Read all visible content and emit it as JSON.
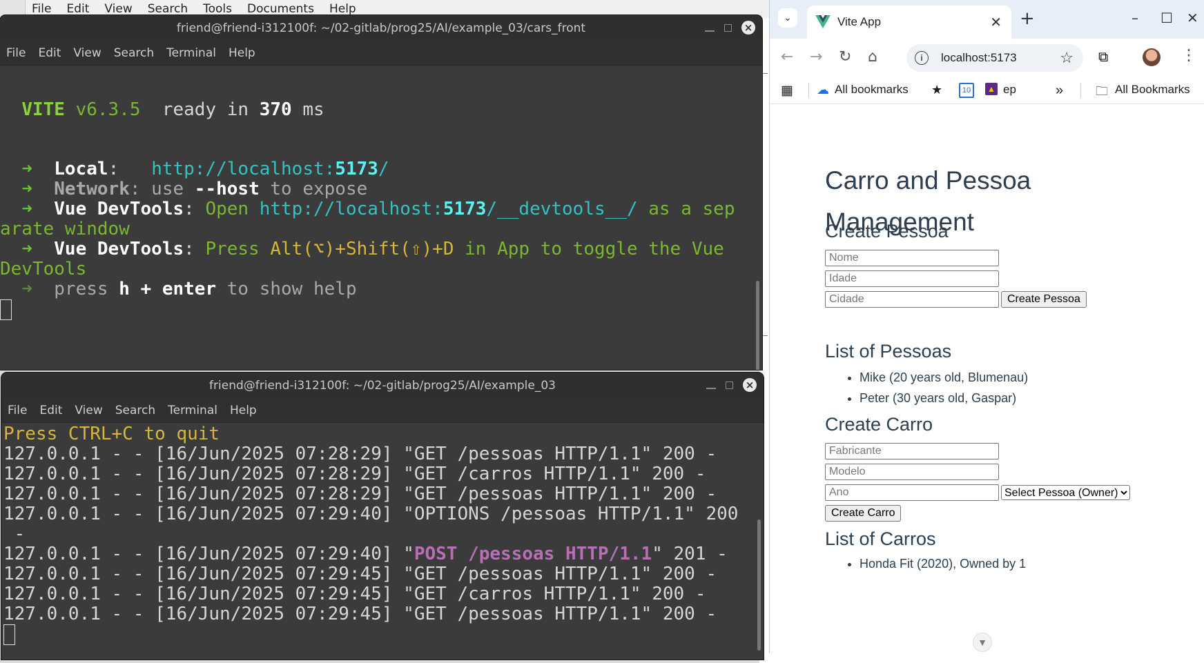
{
  "background_app": {
    "menu": [
      "File",
      "Edit",
      "View",
      "Search",
      "Tools",
      "Documents",
      "Help"
    ]
  },
  "terminal1": {
    "title": "friend@friend-i312100f: ~/02-gitlab/prog25/AI/example_03/cars_front",
    "menu": [
      "File",
      "Edit",
      "View",
      "Search",
      "Terminal",
      "Help"
    ],
    "vite_name": "VITE",
    "vite_version": "v6.3.5",
    "ready_in": "ready in",
    "ready_ms": "370",
    "ms": "ms",
    "arrow": "➜",
    "local_label": "Local",
    "local_url_prefix": "http://localhost:",
    "local_port": "5173",
    "local_url_suffix": "/",
    "network_label": "Network",
    "network_use": "use",
    "network_flag": "--host",
    "network_rest": "to expose",
    "devtools_label": "Vue DevTools",
    "devtools_open": "Open",
    "devtools_url_prefix": "http://localhost:",
    "devtools_port": "5173",
    "devtools_url_suffix": "/__devtools__/",
    "devtools_as": "as a sep",
    "devtools_wrap": "arate window",
    "devtools2_press": "Press",
    "devtools2_keys": "Alt(⌥)+Shift(⇧)+D",
    "devtools2_rest": "in App to toggle the Vue",
    "devtools2_wrap": "DevTools",
    "help_press": "press",
    "help_keys": "h + enter",
    "help_rest": "to show help"
  },
  "terminal2": {
    "title": "friend@friend-i312100f: ~/02-gitlab/prog25/AI/example_03",
    "menu": [
      "File",
      "Edit",
      "View",
      "Search",
      "Terminal",
      "Help"
    ],
    "quit_line": "Press CTRL+C to quit",
    "log": [
      "127.0.0.1 - - [16/Jun/2025 07:28:29] \"GET /pessoas HTTP/1.1\" 200 -",
      "127.0.0.1 - - [16/Jun/2025 07:28:29] \"GET /carros HTTP/1.1\" 200 -",
      "127.0.0.1 - - [16/Jun/2025 07:28:29] \"GET /pessoas HTTP/1.1\" 200 -",
      "127.0.0.1 - - [16/Jun/2025 07:29:40] \"OPTIONS /pessoas HTTP/1.1\" 200",
      " -"
    ],
    "post_prefix": "127.0.0.1 - - [16/Jun/2025 07:29:40] \"",
    "post_req": "POST /pessoas HTTP/1.1",
    "post_suffix": "\" 201 -",
    "log2": [
      "127.0.0.1 - - [16/Jun/2025 07:29:45] \"GET /pessoas HTTP/1.1\" 200 -",
      "127.0.0.1 - - [16/Jun/2025 07:29:45] \"GET /carros HTTP/1.1\" 200 -",
      "127.0.0.1 - - [16/Jun/2025 07:29:45] \"GET /pessoas HTTP/1.1\" 200 -"
    ]
  },
  "browser": {
    "tab_title": "Vite App",
    "url": "localhost:5173",
    "bookmarks": {
      "all_bookmarks": "All bookmarks",
      "ep": "ep",
      "calendar_day": "10",
      "overflow": "»",
      "folder_all": "All Bookmarks"
    },
    "page": {
      "heading": "Carro and Pessoa Management",
      "create_pessoa": "Create Pessoa",
      "nome_placeholder": "Nome",
      "idade_placeholder": "Idade",
      "cidade_placeholder": "Cidade",
      "create_pessoa_button": "Create Pessoa",
      "list_pessoas": "List of Pessoas",
      "pessoas": [
        "Mike (20 years old, Blumenau)",
        "Peter (30 years old, Gaspar)"
      ],
      "create_carro": "Create Carro",
      "fabricante_placeholder": "Fabricante",
      "modelo_placeholder": "Modelo",
      "ano_placeholder": "Ano",
      "owner_select": "Select Pessoa (Owner)",
      "create_carro_button": "Create Carro",
      "list_carros": "List of Carros",
      "carros": [
        "Honda Fit (2020), Owned by 1"
      ]
    }
  },
  "colors": {
    "terminal_bg": "#3b3b3b",
    "vite_green": "#8bd13d",
    "url_cyan": "#33c3c3",
    "yellow": "#d7b63a",
    "magenta": "#b76fb5",
    "page_text": "#2c3e50"
  }
}
